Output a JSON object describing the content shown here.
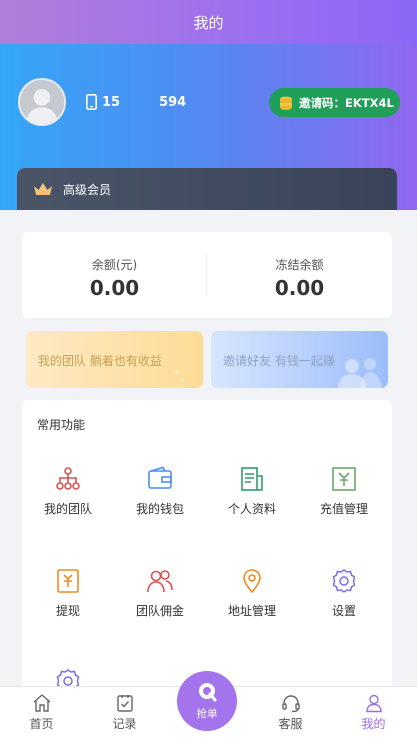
{
  "header": {
    "title": "我的"
  },
  "profile": {
    "phone": "15      594",
    "invite_label": "邀请码：EKTX4L",
    "vip_label": "高级会员"
  },
  "balance": {
    "available_label": "余额(元)",
    "available_value": "0.00",
    "frozen_label": "冻结余额",
    "frozen_value": "0.00"
  },
  "promos": {
    "team": "我的团队 躺着也有收益",
    "invite": "邀请好友 有钱一起赚"
  },
  "functions": {
    "title": "常用功能",
    "items": [
      {
        "label": "我的团队",
        "icon": "team-tree-icon",
        "color": "#d9534f"
      },
      {
        "label": "我的钱包",
        "icon": "wallet-icon",
        "color": "#4a8ff2"
      },
      {
        "label": "个人资料",
        "icon": "profile-doc-icon",
        "color": "#2e9c6a"
      },
      {
        "label": "充值管理",
        "icon": "recharge-icon",
        "color": "#6aa86a"
      },
      {
        "label": "提现",
        "icon": "withdraw-icon",
        "color": "#f08a24"
      },
      {
        "label": "团队佣金",
        "icon": "team-commission-icon",
        "color": "#d9534f"
      },
      {
        "label": "地址管理",
        "icon": "location-icon",
        "color": "#f08a24"
      },
      {
        "label": "设置",
        "icon": "settings-icon",
        "color": "#7a6fe0"
      }
    ],
    "partial_icon": "settings-icon"
  },
  "tabbar": {
    "home": "首页",
    "records": "记录",
    "grab": "抢单",
    "service": "客服",
    "mine": "我的",
    "active_color": "#9a6ce6"
  }
}
